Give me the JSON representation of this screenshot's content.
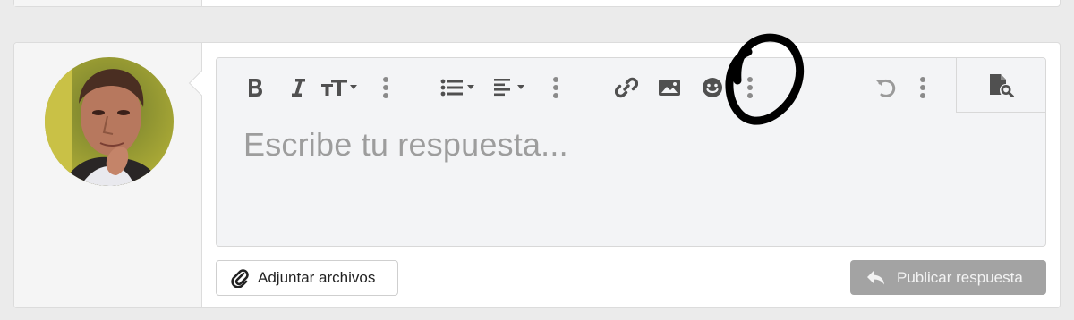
{
  "editor": {
    "placeholder": "Escribe tu respuesta...",
    "toolbar": {
      "buttons": [
        {
          "name": "bold",
          "icon": "bold-icon"
        },
        {
          "name": "italic",
          "icon": "italic-icon"
        },
        {
          "name": "text-size",
          "icon": "text-size-icon"
        },
        {
          "name": "more-text",
          "icon": "more-vertical-icon"
        },
        {
          "name": "list",
          "icon": "list-icon"
        },
        {
          "name": "align",
          "icon": "align-left-icon"
        },
        {
          "name": "more-paragraph",
          "icon": "more-vertical-icon"
        },
        {
          "name": "link",
          "icon": "link-icon"
        },
        {
          "name": "image",
          "icon": "image-icon"
        },
        {
          "name": "emoji",
          "icon": "smiley-icon"
        },
        {
          "name": "more-insert",
          "icon": "more-vertical-icon"
        },
        {
          "name": "undo",
          "icon": "undo-icon"
        },
        {
          "name": "more-misc",
          "icon": "more-vertical-icon"
        },
        {
          "name": "preview",
          "icon": "preview-icon"
        }
      ]
    }
  },
  "actions": {
    "attach_label": "Adjuntar archivos",
    "submit_label": "Publicar respuesta"
  },
  "colors": {
    "page_bg": "#ebebeb",
    "editor_bg": "#f3f4f6",
    "submit_bg": "#a3a3a3",
    "icon": "#505050",
    "annotation": "#000000"
  }
}
